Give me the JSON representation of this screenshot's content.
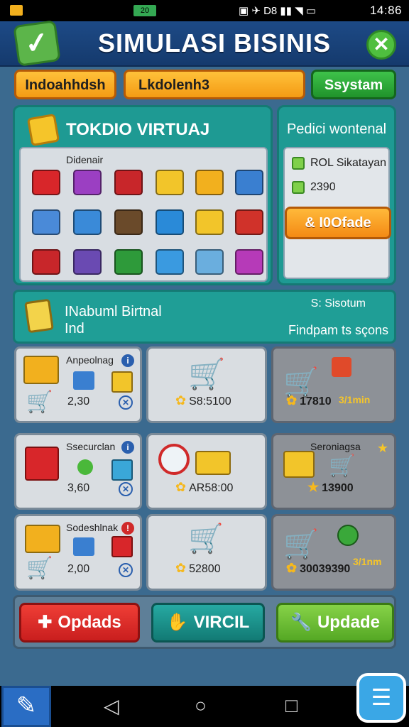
{
  "status_bar": {
    "time": "14:86",
    "network": "D8",
    "left_label": "20"
  },
  "title_bar": {
    "title": "SIMULASI BISINIS",
    "close_label": "✕"
  },
  "tabs": [
    {
      "label": "Indoahhdsh"
    },
    {
      "label": "Lkdolenh3"
    },
    {
      "label": "Ssystam"
    }
  ],
  "store_panel": {
    "title": "TOKDIO VIRTUAJ",
    "grid_label": "Didenair"
  },
  "side_panel": {
    "title": "Pedici wontenal",
    "rows": [
      {
        "label": "ROL Sikatayan"
      },
      {
        "label": "2390"
      }
    ],
    "upgrade_label": "& I0Ofade"
  },
  "banner": {
    "title_line1": "INabuml Birtnal",
    "title_line2": "Ind",
    "right_top": "S: Sisotum",
    "right_bottom": "Findpam ts sçons"
  },
  "cards": [
    {
      "label": "Anpeolnag",
      "value": "2,30"
    },
    {
      "price": "S8:5100"
    },
    {
      "extra": "3/1min",
      "price": "17810"
    },
    {
      "label": "Ssecurclan",
      "value": "3,60"
    },
    {
      "price": "AR58:00"
    },
    {
      "label": "Seroniagsa",
      "price": "13900"
    },
    {
      "label": "Sodeshlnak",
      "value": "2,00"
    },
    {
      "price": "52800"
    },
    {
      "extra": "3/1nm",
      "price": "30039390"
    }
  ],
  "actions": [
    {
      "label": "Opdads"
    },
    {
      "label": "VIRCIL"
    },
    {
      "label": "Updade"
    }
  ],
  "colors": {
    "teal": "#1e9a93",
    "orange": "#f49b14",
    "green": "#20932b",
    "red": "#c91e1e",
    "navy": "#153a6d"
  }
}
